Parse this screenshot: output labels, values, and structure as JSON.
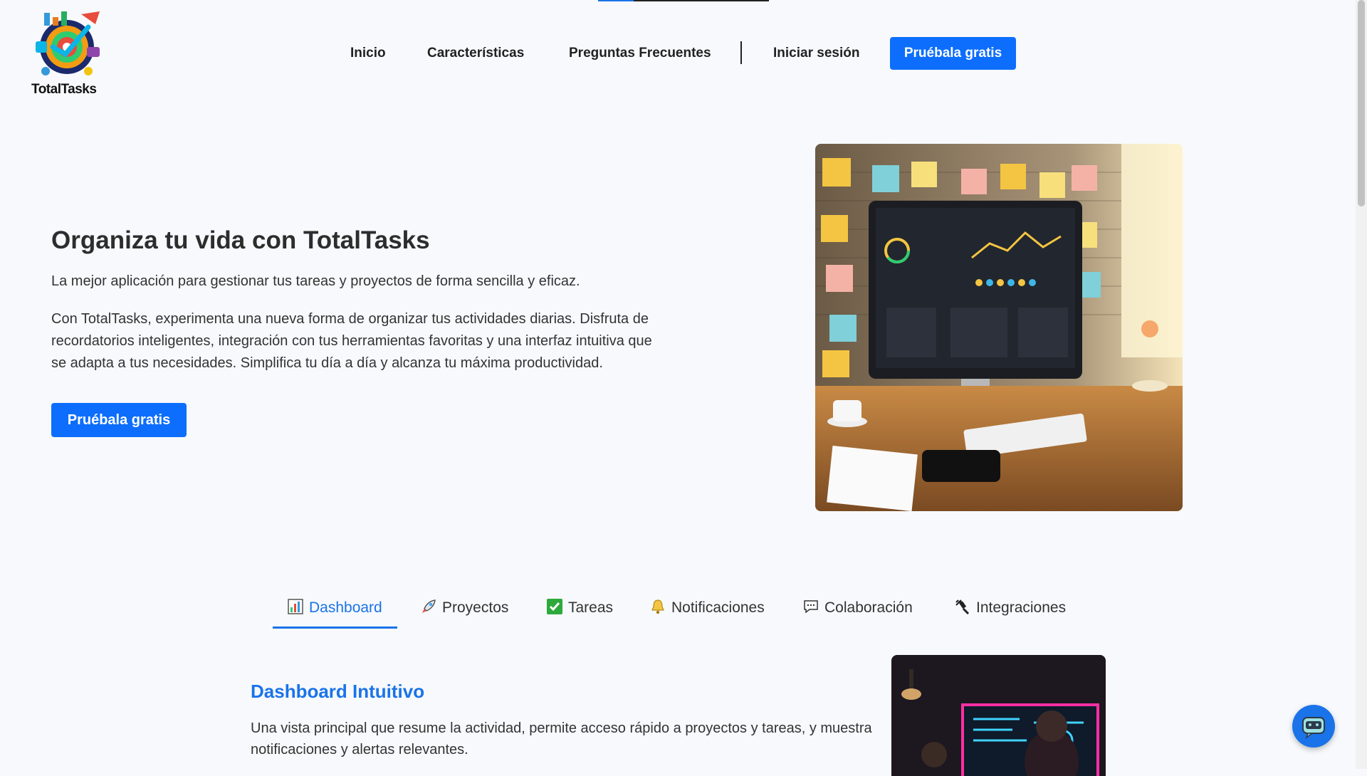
{
  "brand": {
    "name": "TotalTasks",
    "accent": "#0d6efd",
    "logo_icon": "target-gear-logo"
  },
  "nav": {
    "links": [
      "Inicio",
      "Características",
      "Preguntas Frecuentes"
    ],
    "login": "Iniciar sesión",
    "cta": "Pruébala gratis"
  },
  "hero": {
    "title": "Organiza tu vida con TotalTasks",
    "subtitle": "La mejor aplicación para gestionar tus tareas y proyectos de forma sencilla y eficaz.",
    "body": "Con TotalTasks, experimenta una nueva forma de organizar tus actividades diarias. Disfruta de recordatorios inteligentes, integración con tus herramientas favoritas y una interfaz intuitiva que se adapta a tus necesidades. Simplifica tu día a día y alcanza tu máxima productividad.",
    "cta": "Pruébala gratis",
    "image_icon": "desk-dashboard-illustration"
  },
  "tabs": [
    {
      "label": "Dashboard",
      "icon": "bar-chart-icon",
      "active": true
    },
    {
      "label": "Proyectos",
      "icon": "rocket-icon",
      "active": false
    },
    {
      "label": "Tareas",
      "icon": "check-box-icon",
      "active": false
    },
    {
      "label": "Notificaciones",
      "icon": "bell-icon",
      "active": false
    },
    {
      "label": "Colaboración",
      "icon": "speech-bubble-icon",
      "active": false
    },
    {
      "label": "Integraciones",
      "icon": "plug-icon",
      "active": false
    }
  ],
  "feature": {
    "title": "Dashboard Intuitivo",
    "body": "Una vista principal que resume la actividad, permite acceso rápido a proyectos y tareas, y muestra notificaciones y alertas relevantes.",
    "image_icon": "team-dashboard-photo"
  },
  "chat": {
    "icon": "chatbot-icon"
  }
}
